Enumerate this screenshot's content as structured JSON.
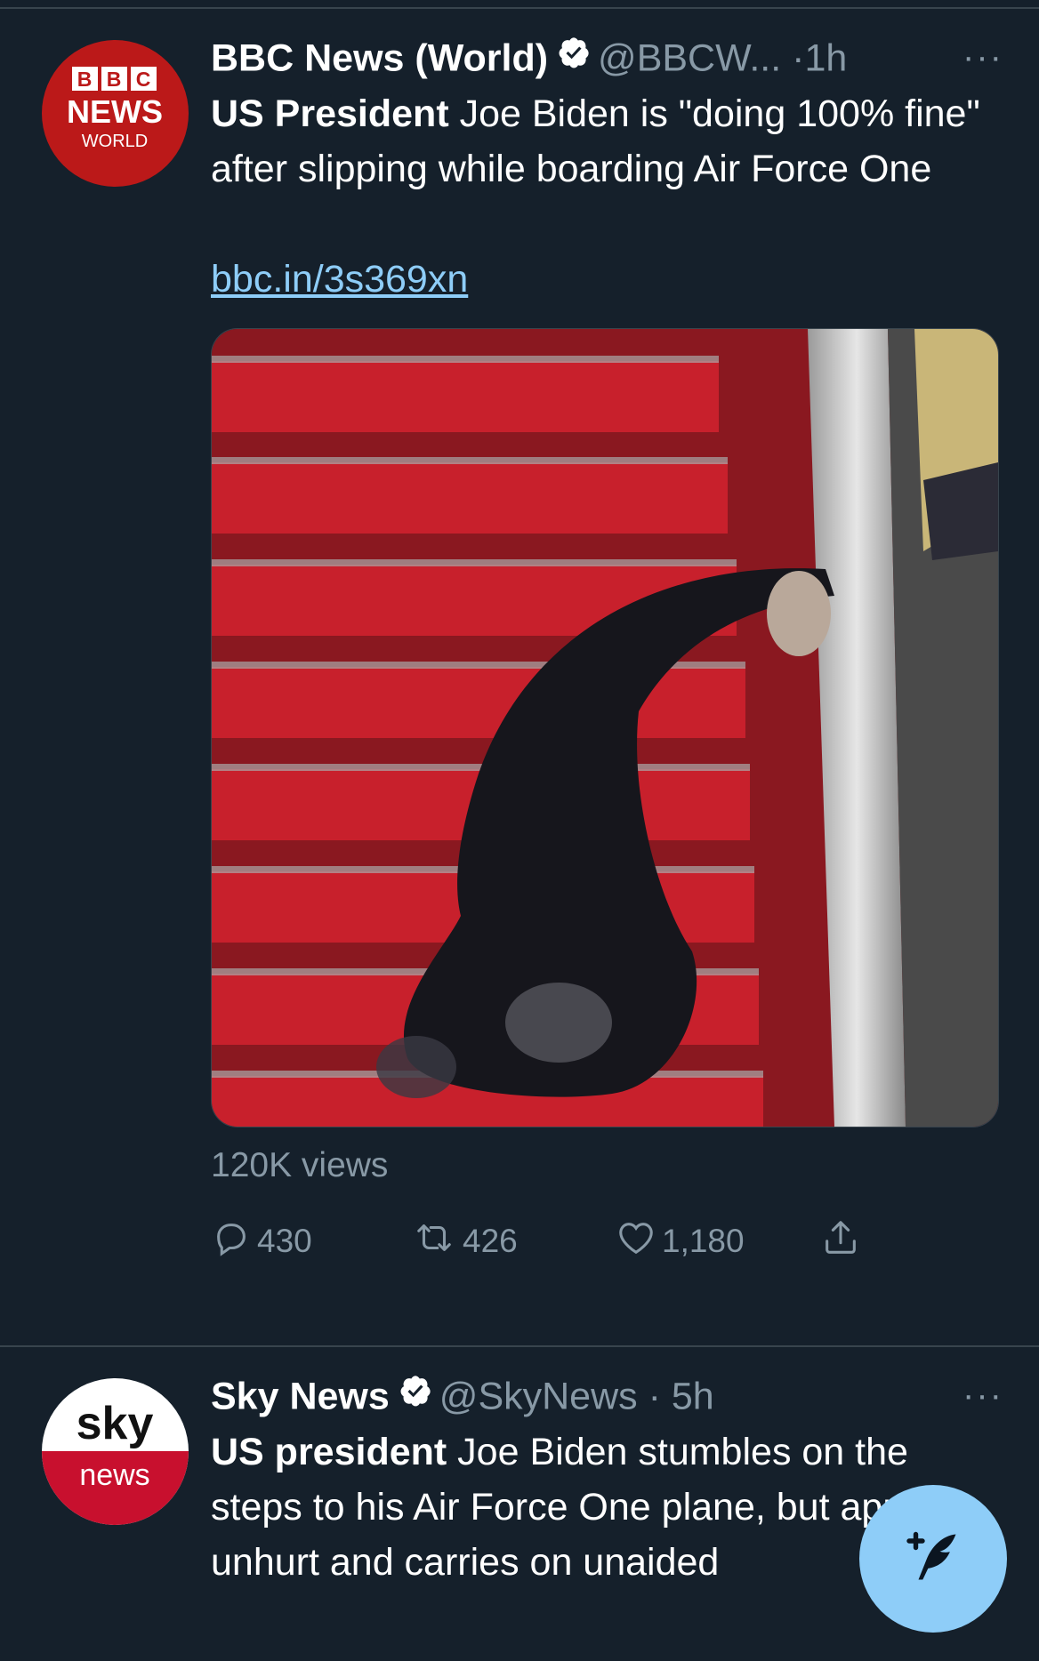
{
  "tweets": [
    {
      "author_name": "BBC News (World)",
      "handle": "@BBCW...",
      "separator": "·",
      "time": "1h",
      "more": "···",
      "text_bold": "US President",
      "text": " Joe Biden is \"doing 100% fine\" after slipping while boarding Air Force One",
      "link": "bbc.in/3s369xn",
      "views": "120K views",
      "replies": "430",
      "retweets": "426",
      "likes": "1,180",
      "avatar": {
        "line1": "BBC",
        "line2": "NEWS",
        "line3": "WORLD"
      }
    },
    {
      "author_name": "Sky News",
      "handle": "@SkyNews",
      "separator": "·",
      "time": "5h",
      "more": "···",
      "text_bold": "US president",
      "text": " Joe Biden stumbles on the steps to his Air Force One plane, but appears unhurt and carries on unaided",
      "avatar": {
        "line1": "sky",
        "line2": "news"
      }
    }
  ],
  "colors": {
    "background": "#15202b",
    "divider": "#38444d",
    "secondary_text": "#8899a6",
    "link": "#8ecdf8",
    "bbc_red": "#bb1919",
    "sky_red": "#c8102e"
  },
  "icons": [
    "verified-badge-icon",
    "more-icon",
    "reply-icon",
    "retweet-icon",
    "like-icon",
    "share-icon",
    "compose-tweet-icon"
  ]
}
